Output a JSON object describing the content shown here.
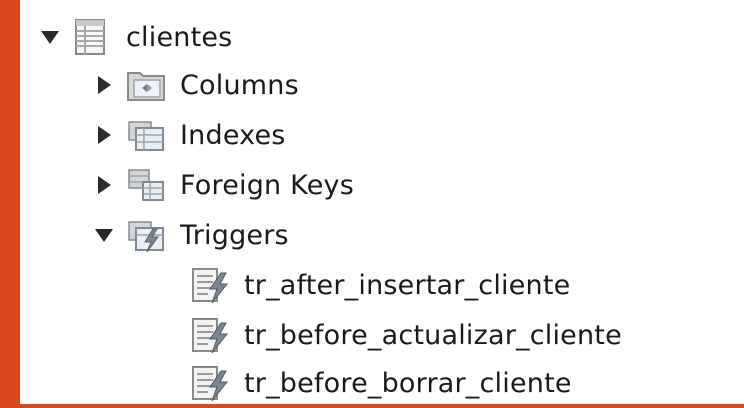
{
  "tree": {
    "table": {
      "label": "clientes",
      "expanded": true,
      "icon": "table-icon"
    },
    "groups": [
      {
        "label": "Columns",
        "expanded": false,
        "icon": "columns-folder-icon"
      },
      {
        "label": "Indexes",
        "expanded": false,
        "icon": "indexes-folder-icon"
      },
      {
        "label": "Foreign Keys",
        "expanded": false,
        "icon": "foreign-keys-folder-icon"
      },
      {
        "label": "Triggers",
        "expanded": true,
        "icon": "triggers-folder-icon"
      }
    ],
    "triggers": [
      {
        "label": "tr_after_insertar_cliente",
        "icon": "trigger-icon"
      },
      {
        "label": "tr_before_actualizar_cliente",
        "icon": "trigger-icon"
      },
      {
        "label": "tr_before_borrar_cliente",
        "icon": "trigger-icon"
      }
    ]
  }
}
